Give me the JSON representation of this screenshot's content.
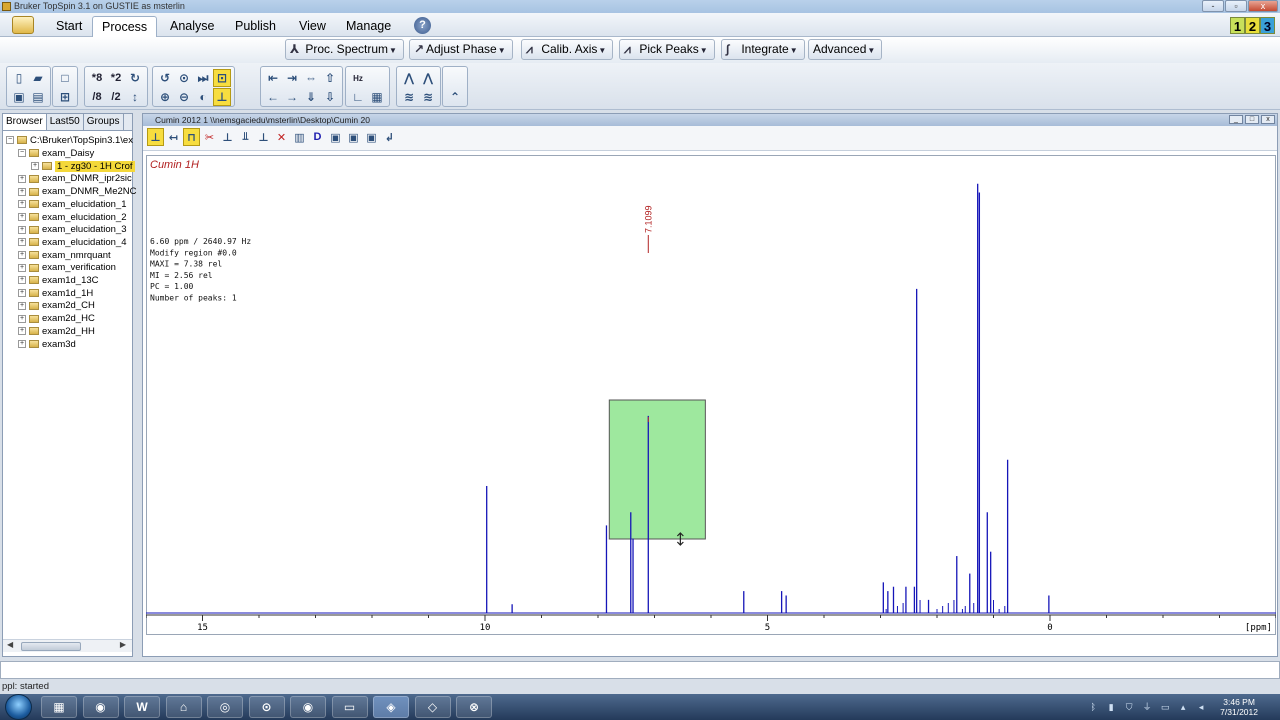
{
  "window": {
    "title": "Bruker TopSpin 3.1 on GUSTIE as msterlin",
    "buttons": [
      "-",
      "▫",
      "x"
    ]
  },
  "menu": {
    "items": [
      "Start",
      "Process",
      "Analyse",
      "Publish",
      "View",
      "Manage"
    ],
    "active": "Process",
    "help": "?",
    "layouts": [
      "1",
      "2",
      "3"
    ]
  },
  "commands": [
    {
      "icon": "⅄",
      "label": "Proc. Spectrum"
    },
    {
      "icon": "↗",
      "label": "Adjust Phase"
    },
    {
      "icon": "⩘",
      "label": "Calib. Axis"
    },
    {
      "icon": "⩘",
      "label": "Pick Peaks"
    },
    {
      "icon": "∫",
      "label": "Integrate"
    },
    {
      "icon": "",
      "label": "Advanced"
    }
  ],
  "toolbar_labels": {
    "a": "*8",
    "b": "*2",
    "c": "/8",
    "d": "/2",
    "hz": "Hz",
    "ppm": "ppm"
  },
  "browser": {
    "tabs": [
      "Browser",
      "Last50",
      "Groups"
    ],
    "root": "C:\\Bruker\\TopSpin3.1\\ex",
    "items": [
      {
        "label": "exam_Daisy",
        "level": 1,
        "expanded": true
      },
      {
        "label": "1 - zg30 - 1H Crof",
        "level": 2,
        "selected": true
      },
      {
        "label": "exam_DNMR_ipr2sic",
        "level": 1
      },
      {
        "label": "exam_DNMR_Me2NC",
        "level": 1
      },
      {
        "label": "exam_elucidation_1",
        "level": 1
      },
      {
        "label": "exam_elucidation_2",
        "level": 1
      },
      {
        "label": "exam_elucidation_3",
        "level": 1
      },
      {
        "label": "exam_elucidation_4",
        "level": 1
      },
      {
        "label": "exam_nmrquant",
        "level": 1
      },
      {
        "label": "exam_verification",
        "level": 1
      },
      {
        "label": "exam1d_13C",
        "level": 1
      },
      {
        "label": "exam1d_1H",
        "level": 1
      },
      {
        "label": "exam2d_CH",
        "level": 1
      },
      {
        "label": "exam2d_HC",
        "level": 1
      },
      {
        "label": "exam2d_HH",
        "level": 1
      },
      {
        "label": "exam3d",
        "level": 1
      }
    ]
  },
  "spectrum_window": {
    "title": "Cumin 2012 1 \\\\nemsgaciedu\\msterlin\\Desktop\\Cumin 20"
  },
  "spectrum": {
    "title": "Cumin 1H",
    "info_lines": [
      "6.60 ppm / 2640.97 Hz",
      "Modify region #0.0",
      "MAXI = 7.38 rel",
      "MI = 2.56 rel",
      "PC = 1.00",
      "Number of peaks: 1"
    ],
    "peak_label": "7.1099",
    "x_unit": "[ppm]",
    "line_color": "#1515b8",
    "highlight_color": "#9ee89e"
  },
  "chart_data": {
    "type": "line",
    "title": "Cumin 1H",
    "xlabel": "[ppm]",
    "ylabel": "",
    "xlim": [
      16,
      -4
    ],
    "reversed_x": true,
    "ylim": [
      0,
      1
    ],
    "x_ticks": [
      15,
      10,
      5,
      0
    ],
    "peaks": [
      {
        "ppm": 9.97,
        "h": 0.29
      },
      {
        "ppm": 9.52,
        "h": 0.02
      },
      {
        "ppm": 7.85,
        "h": 0.2
      },
      {
        "ppm": 7.42,
        "h": 0.23
      },
      {
        "ppm": 7.38,
        "h": 0.17
      },
      {
        "ppm": 7.11,
        "h": 0.45
      },
      {
        "ppm": 5.42,
        "h": 0.05
      },
      {
        "ppm": 4.75,
        "h": 0.05
      },
      {
        "ppm": 4.67,
        "h": 0.04
      },
      {
        "ppm": 2.95,
        "h": 0.07
      },
      {
        "ppm": 2.87,
        "h": 0.05
      },
      {
        "ppm": 2.77,
        "h": 0.06
      },
      {
        "ppm": 2.55,
        "h": 0.06
      },
      {
        "ppm": 2.4,
        "h": 0.06
      },
      {
        "ppm": 2.36,
        "h": 0.74
      },
      {
        "ppm": 2.15,
        "h": 0.03
      },
      {
        "ppm": 1.65,
        "h": 0.13
      },
      {
        "ppm": 1.42,
        "h": 0.09
      },
      {
        "ppm": 1.28,
        "h": 0.98
      },
      {
        "ppm": 1.25,
        "h": 0.96
      },
      {
        "ppm": 1.11,
        "h": 0.23
      },
      {
        "ppm": 1.05,
        "h": 0.14
      },
      {
        "ppm": 0.75,
        "h": 0.35
      },
      {
        "ppm": 0.02,
        "h": 0.04
      }
    ],
    "region": {
      "ppm_from": 7.8,
      "ppm_to": 6.1
    }
  },
  "status": {
    "input": "",
    "message": "ppl: started"
  },
  "taskbar": {
    "apps": [
      "▦",
      "◉",
      "W",
      "⌂",
      "◎",
      "⊙",
      "◉",
      "▭",
      "◈",
      "◇",
      "⊗"
    ],
    "time": "3:46 PM",
    "date": "7/31/2012"
  }
}
